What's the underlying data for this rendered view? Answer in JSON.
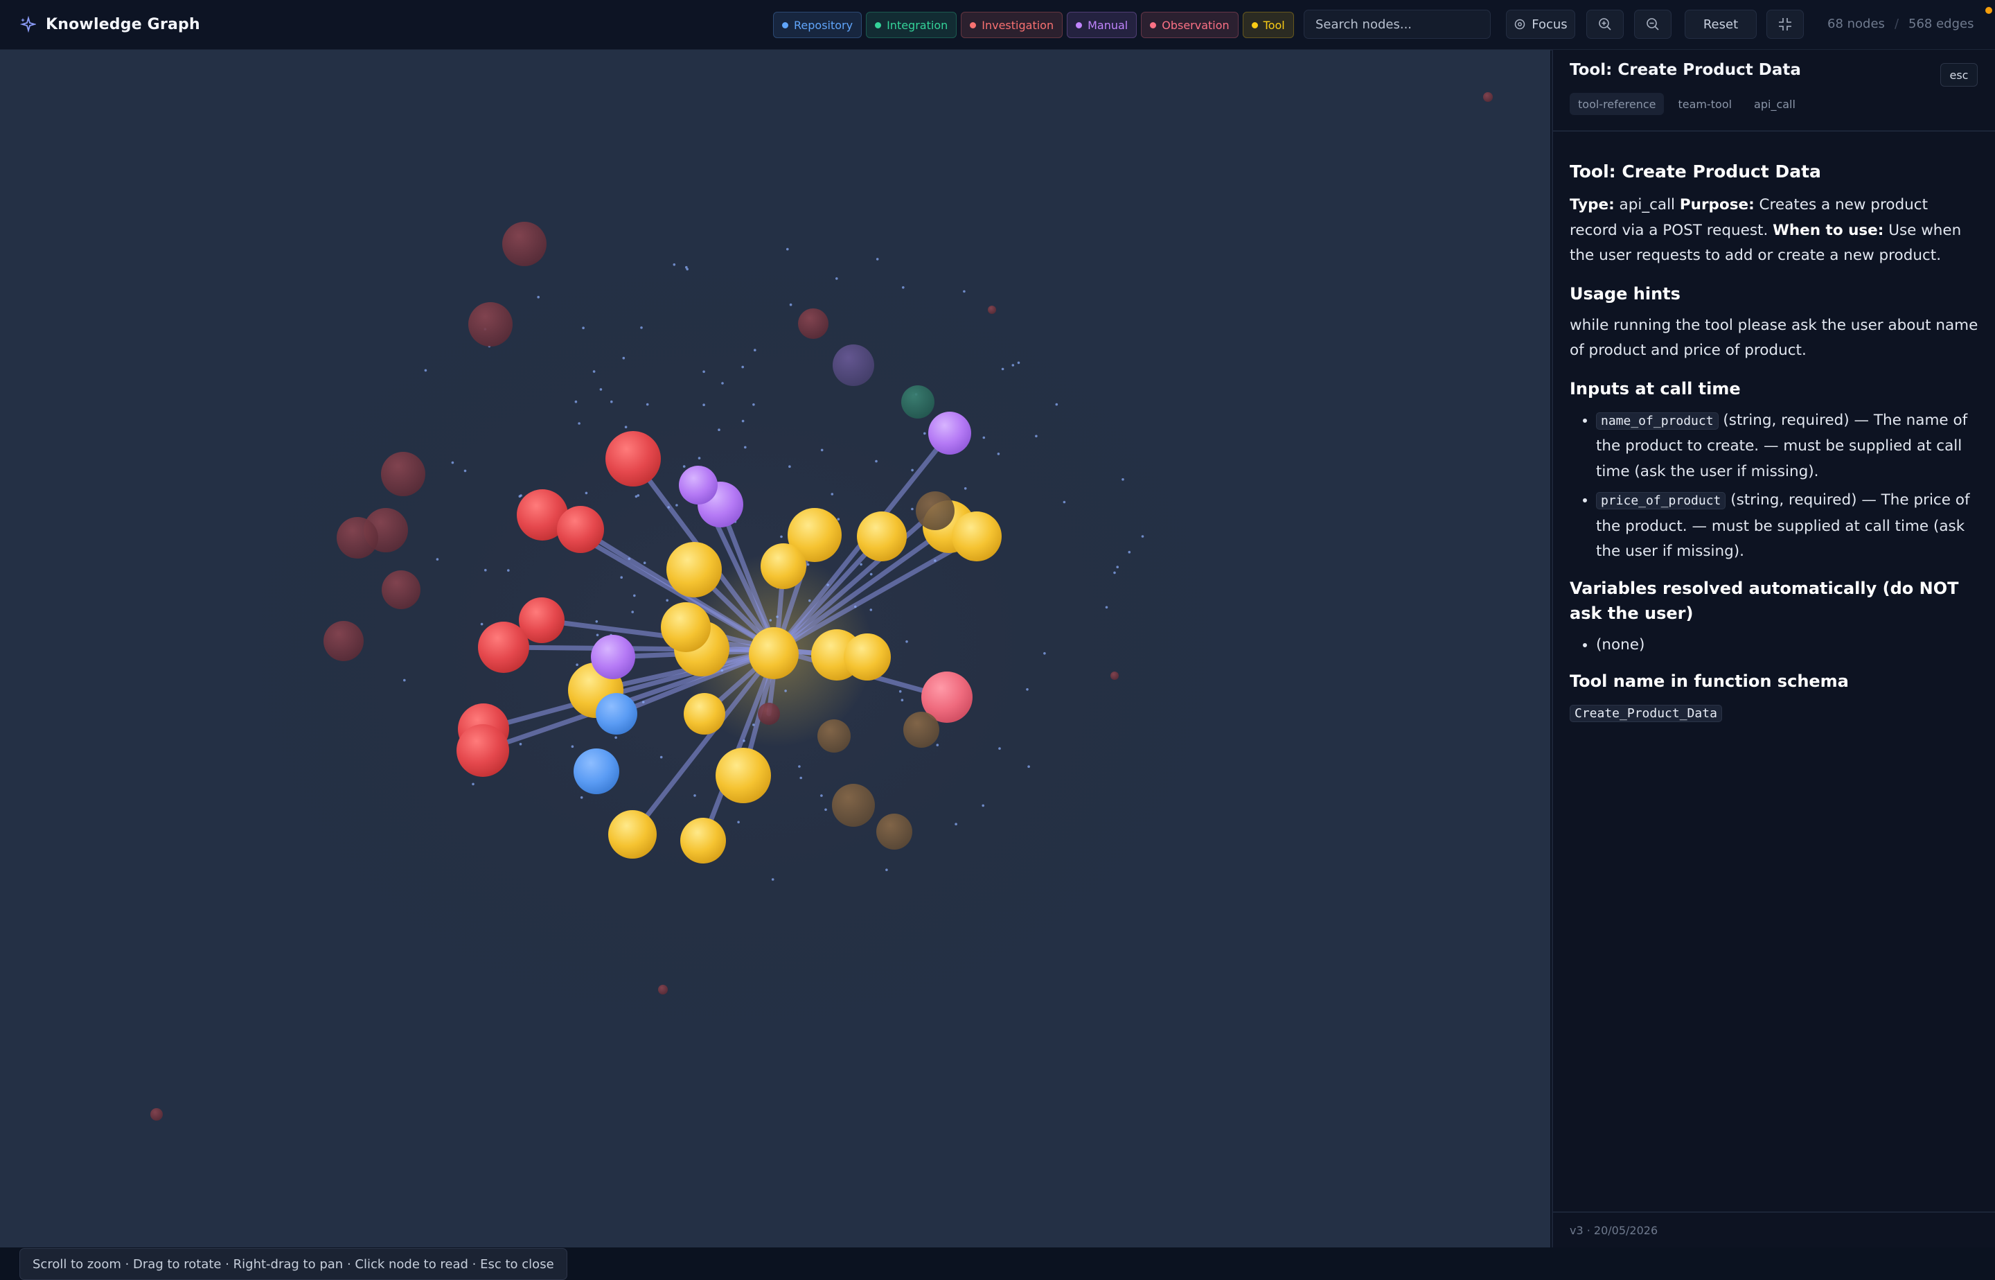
{
  "app": {
    "title": "Knowledge Graph"
  },
  "filters": [
    {
      "label": "Repository",
      "color": "#60a5fa"
    },
    {
      "label": "Integration",
      "color": "#34d399"
    },
    {
      "label": "Investigation",
      "color": "#f87171"
    },
    {
      "label": "Manual",
      "color": "#c084fc"
    },
    {
      "label": "Observation",
      "color": "#fb7185"
    },
    {
      "label": "Tool",
      "color": "#facc15"
    }
  ],
  "search": {
    "placeholder": "Search nodes..."
  },
  "toolbar": {
    "focus_label": "Focus",
    "reset_label": "Reset",
    "nodes_count": "68 nodes",
    "edges_count": "568 edges",
    "separator": "/"
  },
  "canvas": {
    "hint": "Scroll to zoom · Drag to rotate · Right-drag to pan · Click node to read · Esc to close",
    "node_colors": {
      "tool": "#f6c93c",
      "investigation": "#e5484d",
      "manual": "#b57af5",
      "repository": "#5b9cf4",
      "observation": "#ef6b7e",
      "integration": "#2f8f7a"
    }
  },
  "panel": {
    "title": "Tool: Create Product Data",
    "esc_label": "esc",
    "tags": [
      "tool-reference",
      "team-tool",
      "api_call"
    ],
    "heading": "Tool: Create Product Data",
    "type_label": "Type:",
    "type_value": "api_call",
    "purpose_label": "Purpose:",
    "purpose_value": "Creates a new product record via a POST request.",
    "when_label": "When to use:",
    "when_value": "Use when the user requests to add or create a new product.",
    "usage_heading": "Usage hints",
    "usage_text": "while running the tool please ask the user about name of product and price of product.",
    "inputs_heading": "Inputs at call time",
    "inputs": [
      {
        "name": "name_of_product",
        "desc": "(string, required) — The name of the product to create. — must be supplied at call time (ask the user if missing)."
      },
      {
        "name": "price_of_product",
        "desc": "(string, required) — The price of the product. — must be supplied at call time (ask the user if missing)."
      }
    ],
    "variables_heading": "Variables resolved automatically (do NOT ask the user)",
    "variables": [
      "(none)"
    ],
    "schema_heading": "Tool name in function schema",
    "schema_name": "Create_Product_Data",
    "version": "v3 · 20/05/2026"
  }
}
